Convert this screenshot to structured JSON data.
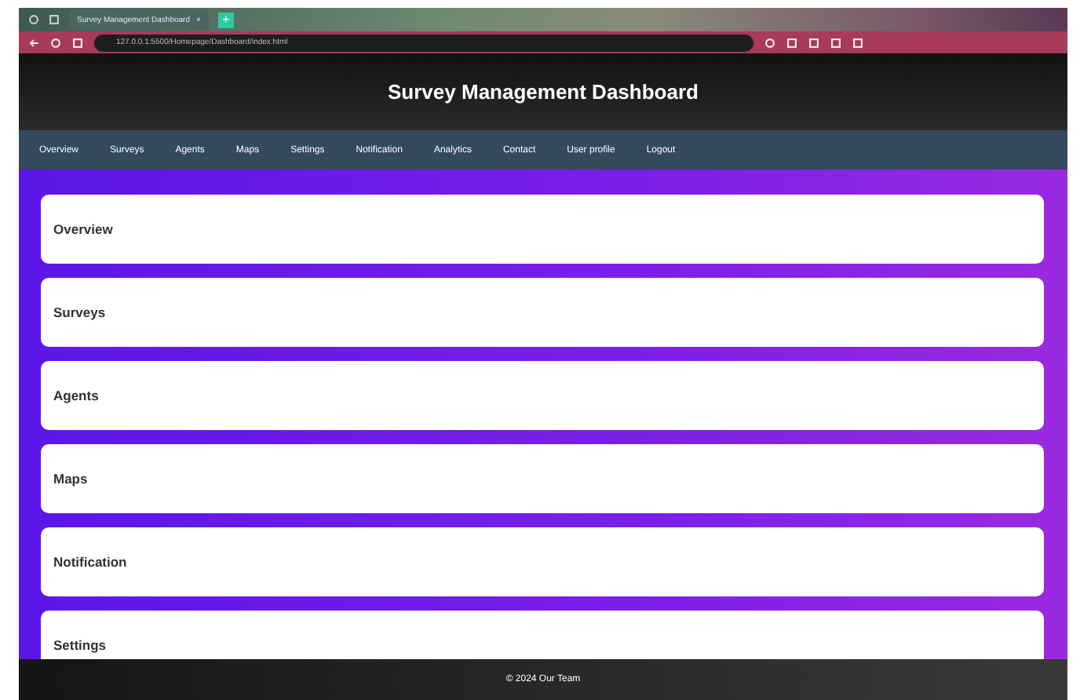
{
  "browser": {
    "tab_title": "Survey Management Dashboard",
    "tab_close": "×",
    "new_tab": "+",
    "url": "127.0.0.1:5500/Homepage/Dashboard/index.html"
  },
  "header": {
    "title": "Survey Management Dashboard"
  },
  "nav": [
    "Overview",
    "Surveys",
    "Agents",
    "Maps",
    "Settings",
    "Notification",
    "Analytics",
    "Contact",
    "User profile",
    "Logout"
  ],
  "sections": [
    "Overview",
    "Surveys",
    "Agents",
    "Maps",
    "Notification",
    "Settings"
  ],
  "footer": "© 2024 Our Team"
}
